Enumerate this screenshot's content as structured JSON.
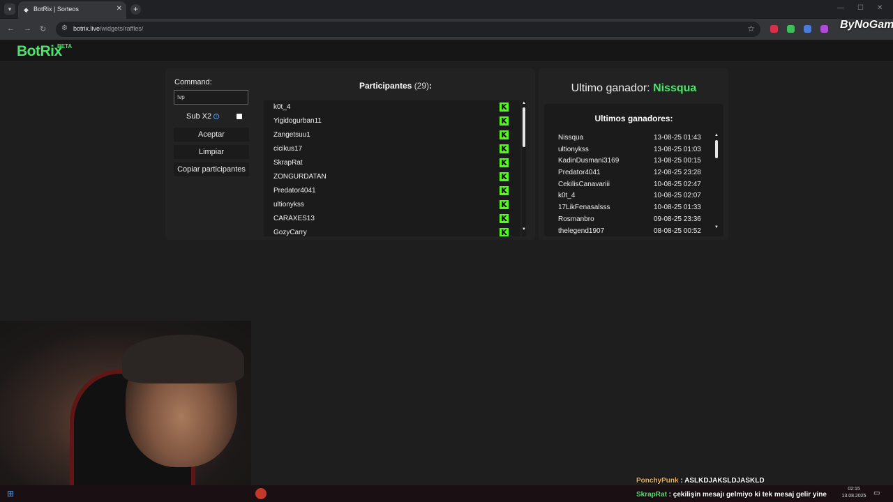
{
  "browser": {
    "tab_title": "BotRix | Sorteos",
    "url_host": "botrix.live",
    "url_path": "/widgets/raffles/",
    "watermark": "ByNoGame"
  },
  "app": {
    "logo": "BotRix",
    "logo_badge": "BETA"
  },
  "controls": {
    "command_label": "Command:",
    "command_value": "!vp",
    "sub_label": "Sub X2",
    "accept_label": "Aceptar",
    "clear_label": "Limpiar",
    "copy_label": "Copiar participantes"
  },
  "participants": {
    "title": "Participantes",
    "count": "(29)",
    "colon": ":",
    "items": [
      "k0t_4",
      "Yigidogurban11",
      "Zangetsuu1",
      "cicikus17",
      "SkrapRat",
      "ZONGURDATAN",
      "Predator4041",
      "ultionykss",
      "CARAXES13",
      "GozyCarry"
    ]
  },
  "winners": {
    "last_label": "Ultimo ganador:",
    "last_name": "Nissqua",
    "list_title": "Ultimos ganadores:",
    "items": [
      {
        "name": "Nissqua",
        "date": "13-08-25 01:43"
      },
      {
        "name": "ultionykss",
        "date": "13-08-25 01:03"
      },
      {
        "name": "KadinDusmani3169",
        "date": "13-08-25 00:15"
      },
      {
        "name": "Predator4041",
        "date": "12-08-25 23:28"
      },
      {
        "name": "CekilisCanavariii",
        "date": "10-08-25 02:47"
      },
      {
        "name": "k0t_4",
        "date": "10-08-25 02:07"
      },
      {
        "name": "17LikFenasalsss",
        "date": "10-08-25 01:33"
      },
      {
        "name": "Rosmanbro",
        "date": "09-08-25 23:36"
      },
      {
        "name": "thelegend1907",
        "date": "08-08-25 00:52"
      }
    ]
  },
  "chat": [
    {
      "user": "PonchyPunk",
      "text": " : ASLKDJAKSLDJASKLD"
    },
    {
      "user": "SkrapRat",
      "text": " : çekilişin mesajı gelmiyo ki tek mesaj gelir yine"
    }
  ],
  "clock": {
    "time": "02:15",
    "date": "13.08.2025"
  },
  "colors": {
    "accent": "#4ee36a",
    "kick": "#53fc18",
    "background": "#1e1e1e"
  }
}
